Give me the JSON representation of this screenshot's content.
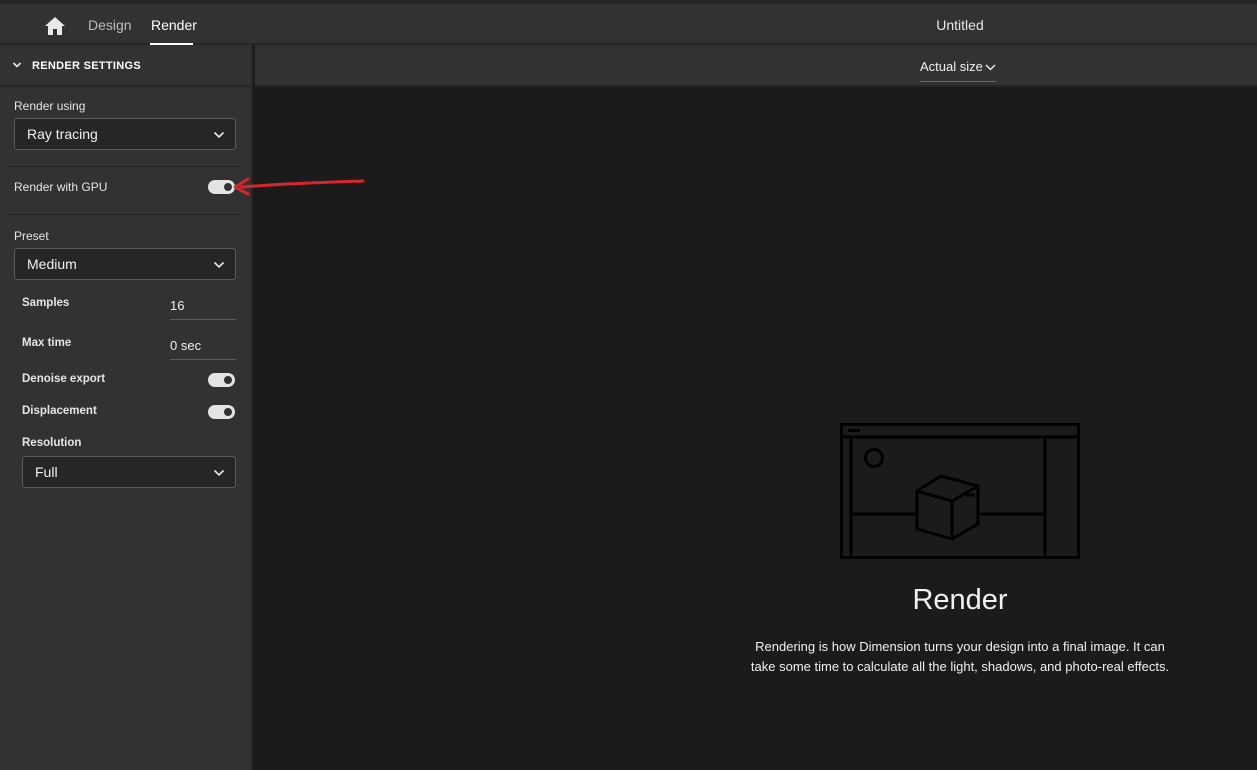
{
  "topbar": {
    "tabs": [
      {
        "label": "Design",
        "active": false
      },
      {
        "label": "Render",
        "active": true
      }
    ],
    "document_title": "Untitled"
  },
  "sidebar": {
    "section_title": "RENDER SETTINGS",
    "render_using": {
      "label": "Render using",
      "value": "Ray tracing"
    },
    "render_with_gpu": {
      "label": "Render with GPU",
      "enabled": true
    },
    "preset": {
      "label": "Preset",
      "value": "Medium"
    },
    "samples": {
      "label": "Samples",
      "value": "16"
    },
    "max_time": {
      "label": "Max time",
      "value": "0 sec"
    },
    "denoise_export": {
      "label": "Denoise export",
      "enabled": true
    },
    "displacement": {
      "label": "Displacement",
      "enabled": true
    },
    "resolution": {
      "label": "Resolution",
      "value": "Full"
    }
  },
  "viewbar": {
    "zoom_value": "Actual size"
  },
  "canvas": {
    "empty_title": "Render",
    "empty_description_line1": "Rendering is how Dimension turns your design into a final image. It can",
    "empty_description_line2": "take some time to calculate all the light, shadows, and photo-real effects."
  },
  "colors": {
    "panel_bg": "#323232",
    "canvas_bg": "#1b1b1b",
    "border": "#262626",
    "annotation_red": "#d7262b"
  },
  "icons": [
    "home-icon",
    "chevron-down-icon",
    "render-illustration-icon",
    "annotation-arrow"
  ]
}
